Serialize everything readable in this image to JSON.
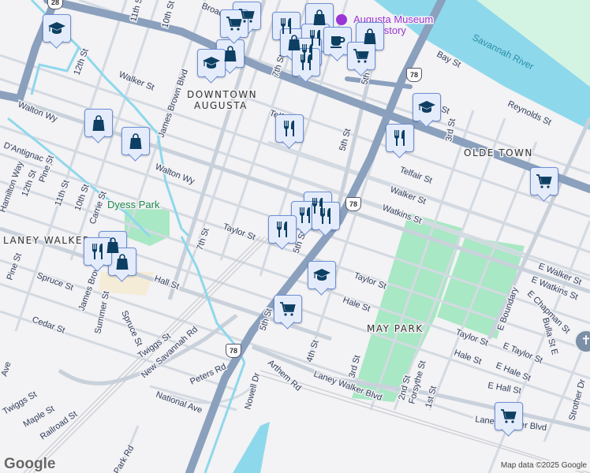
{
  "map": {
    "neighborhoods": {
      "downtown_1": "DOWNTOWN",
      "downtown_2": "AUGUSTA",
      "olde_town": "OLDE TOWN",
      "laney_walker": "LANEY WALKER",
      "may_park": "MAY PARK"
    },
    "parks": {
      "dyess": "Dyess Park"
    },
    "water": {
      "river": "Savannah River"
    },
    "poi": {
      "museum_1": "Augusta Museum",
      "museum_2": "of History"
    },
    "shields": [
      "78",
      "78",
      "78",
      "28"
    ],
    "streets": {
      "broad_w": "Broad St",
      "broad_e": "Broad St",
      "s12th_n": "12th St",
      "s11th_n": "11th St",
      "s10th_n": "10th St",
      "walker_w": "Walker St",
      "jbb_n": "James Brown Blvd",
      "walton_1": "Walton Wy",
      "walton_2": "Walton Wy",
      "dantignac": "D'Antignac St",
      "hamilton": "Hamilton Way",
      "s12th_s": "12th St",
      "pine_n": "Pine St",
      "s11th_s": "11th St",
      "s10th_s": "10th St",
      "carrie": "Carrie St",
      "taylor_w": "Taylor St",
      "s7th_s": "7th St",
      "s7th_n": "7th St",
      "s5th_a": "5th St",
      "s5th_b": "5th St",
      "s5th_c": "5th St",
      "s5th_d": "5th St",
      "telfair_w": "Telfair St",
      "telfair_e": "Telfair St",
      "walker_e": "Walker St",
      "watkins": "Watkins St",
      "bay": "Bay St",
      "reynolds": "Reynolds St",
      "s3rd_n": "3rd St",
      "pine_s": "Pine St",
      "spruce_1": "Spruce St",
      "jbb_s": "James Brown Blvd",
      "hall": "Hall St",
      "summer": "Summer St",
      "spruce_2": "Spruce St",
      "cedar": "Cedar St",
      "twiggs_1": "Twiggs St",
      "twiggs_2": "Twiggs St",
      "maple": "Maple St",
      "railroad": "Railroad St",
      "new_savannah": "New Savannah Rd",
      "peters": "Peters Rd",
      "national": "National Ave",
      "nowell": "Nowell Dr",
      "arthem": "Arthem Rd",
      "park_rd": "Park Rd",
      "ave_w": "Ave",
      "s4th": "4th St",
      "taylor_c": "Taylor St",
      "hale_c": "Hale St",
      "s3rd_s": "3rd St",
      "s2nd": "2nd St",
      "forsythe": "Forsythe St",
      "s1st": "1st St",
      "taylor_e": "Taylor St",
      "e_taylor": "E Taylor St",
      "hale_e": "Hale St",
      "e_hale": "E Hale St",
      "e_hall": "E Hall St",
      "e_walker": "E Walker St",
      "e_watkins": "E Watkins St",
      "e_chapman": "E Chapman St",
      "e_boundary": "E Boundary",
      "bulla": "Bulla St E",
      "strother": "Strother Dr",
      "lwb_w": "Laney Walker Blvd",
      "lwb_e": "Laney Walker Blvd"
    },
    "markers": [
      {
        "icon": "school-icon"
      },
      {
        "icon": "shopping-bag-icon"
      },
      {
        "icon": "shopping-bag-icon"
      },
      {
        "icon": "school-icon"
      },
      {
        "icon": "shopping-bag-icon"
      },
      {
        "icon": "shopping-cart-icon"
      },
      {
        "icon": "shopping-cart-icon"
      },
      {
        "icon": "restaurant-icon"
      },
      {
        "icon": "shopping-bag-icon"
      },
      {
        "icon": "shopping-bag-icon"
      },
      {
        "icon": "restaurant-icon"
      },
      {
        "icon": "restaurant-icon"
      },
      {
        "icon": "coffee-icon"
      },
      {
        "icon": "shopping-bag-icon"
      },
      {
        "icon": "shopping-cart-icon"
      },
      {
        "icon": "restaurant-icon"
      },
      {
        "icon": "restaurant-icon"
      },
      {
        "icon": "school-icon"
      },
      {
        "icon": "shopping-cart-icon"
      },
      {
        "icon": "restaurant-icon"
      },
      {
        "icon": "restaurant-icon"
      },
      {
        "icon": "restaurant-icon"
      },
      {
        "icon": "restaurant-icon"
      },
      {
        "icon": "shopping-bag-icon"
      },
      {
        "icon": "restaurant-icon"
      },
      {
        "icon": "shopping-bag-icon"
      },
      {
        "icon": "school-icon"
      },
      {
        "icon": "shopping-cart-icon"
      },
      {
        "icon": "shopping-cart-icon"
      }
    ],
    "attribution": "Map data ©2025 Google",
    "logo": "Google",
    "colors": {
      "highway": "#8aa0bd",
      "water": "#8ed8ec",
      "park": "#a8e8c4",
      "marker_bg": "#e4ecfb",
      "marker_icon": "#0d3f63"
    }
  }
}
